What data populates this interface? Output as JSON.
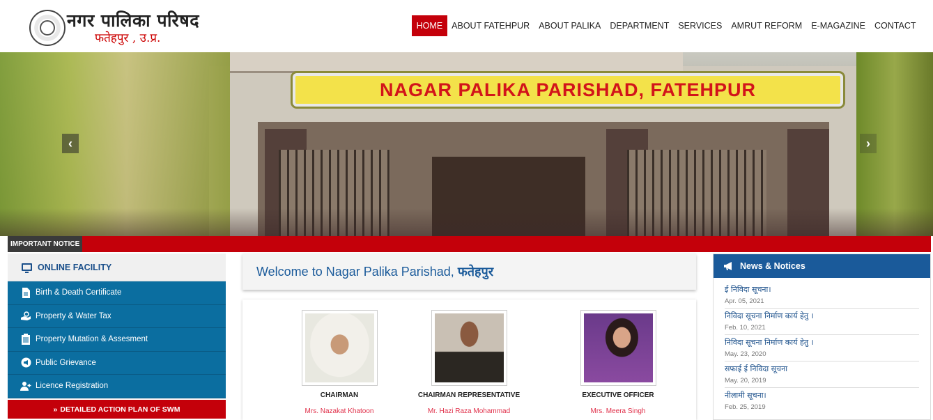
{
  "header": {
    "logo_title": "नगर पालिका परिषद",
    "logo_subtitle": "फतेहपुर , उ.प्र."
  },
  "nav": [
    {
      "label": "HOME",
      "active": true
    },
    {
      "label": "ABOUT FATEHPUR",
      "active": false
    },
    {
      "label": "ABOUT PALIKA",
      "active": false
    },
    {
      "label": "DEPARTMENT",
      "active": false
    },
    {
      "label": "SERVICES",
      "active": false
    },
    {
      "label": "AMRUT REFORM",
      "active": false
    },
    {
      "label": "E-MAGAZINE",
      "active": false
    },
    {
      "label": "CONTACT",
      "active": false
    }
  ],
  "hero": {
    "banner_text": "NAGAR PALIKA PARISHAD, FATEHPUR",
    "prev_icon": "chevron-left-icon",
    "next_icon": "chevron-right-icon"
  },
  "notice": {
    "label": "IMPORTANT NOTICE"
  },
  "online_facility": {
    "title": "ONLINE FACILITY",
    "items": [
      {
        "label": "Birth & Death Certificate",
        "icon": "document-icon"
      },
      {
        "label": "Property & Water Tax",
        "icon": "hand-money-icon"
      },
      {
        "label": "Property Mutation & Assesment",
        "icon": "clipboard-icon"
      },
      {
        "label": "Public Grievance",
        "icon": "megaphone-icon"
      },
      {
        "label": "Licence Registration",
        "icon": "user-add-icon"
      }
    ],
    "swm_button": "DETAILED ACTION PLAN OF SWM"
  },
  "welcome": {
    "text": "Welcome to Nagar Palika Parishad,",
    "city": "फतेहपुर"
  },
  "officials": [
    {
      "role": "CHAIRMAN",
      "name": "Mrs. Nazakat Khatoon"
    },
    {
      "role": "CHAIRMAN REPRESENTATIVE",
      "name": "Mr. Hazi Raza Mohammad"
    },
    {
      "role": "EXECUTIVE OFFICER",
      "name": "Mrs. Meera Singh"
    }
  ],
  "news": {
    "title": "News & Notices",
    "items": [
      {
        "title": "ई निविदा सूचना।",
        "date": "Apr. 05, 2021"
      },
      {
        "title": "निविदा सूचना निर्माण कार्य हेतु ।",
        "date": "Feb. 10, 2021"
      },
      {
        "title": "निविदा सूचना निर्माण कार्य हेतु ।",
        "date": "May. 23, 2020"
      },
      {
        "title": "सफाई ई निविदा सूचना",
        "date": "May. 20, 2019"
      },
      {
        "title": "नीलामी सूचना।",
        "date": "Feb. 25, 2019"
      }
    ]
  },
  "colors": {
    "brand_red": "#c4000a",
    "brand_blue": "#0b6ea0",
    "heading_blue": "#1a5a9a"
  }
}
